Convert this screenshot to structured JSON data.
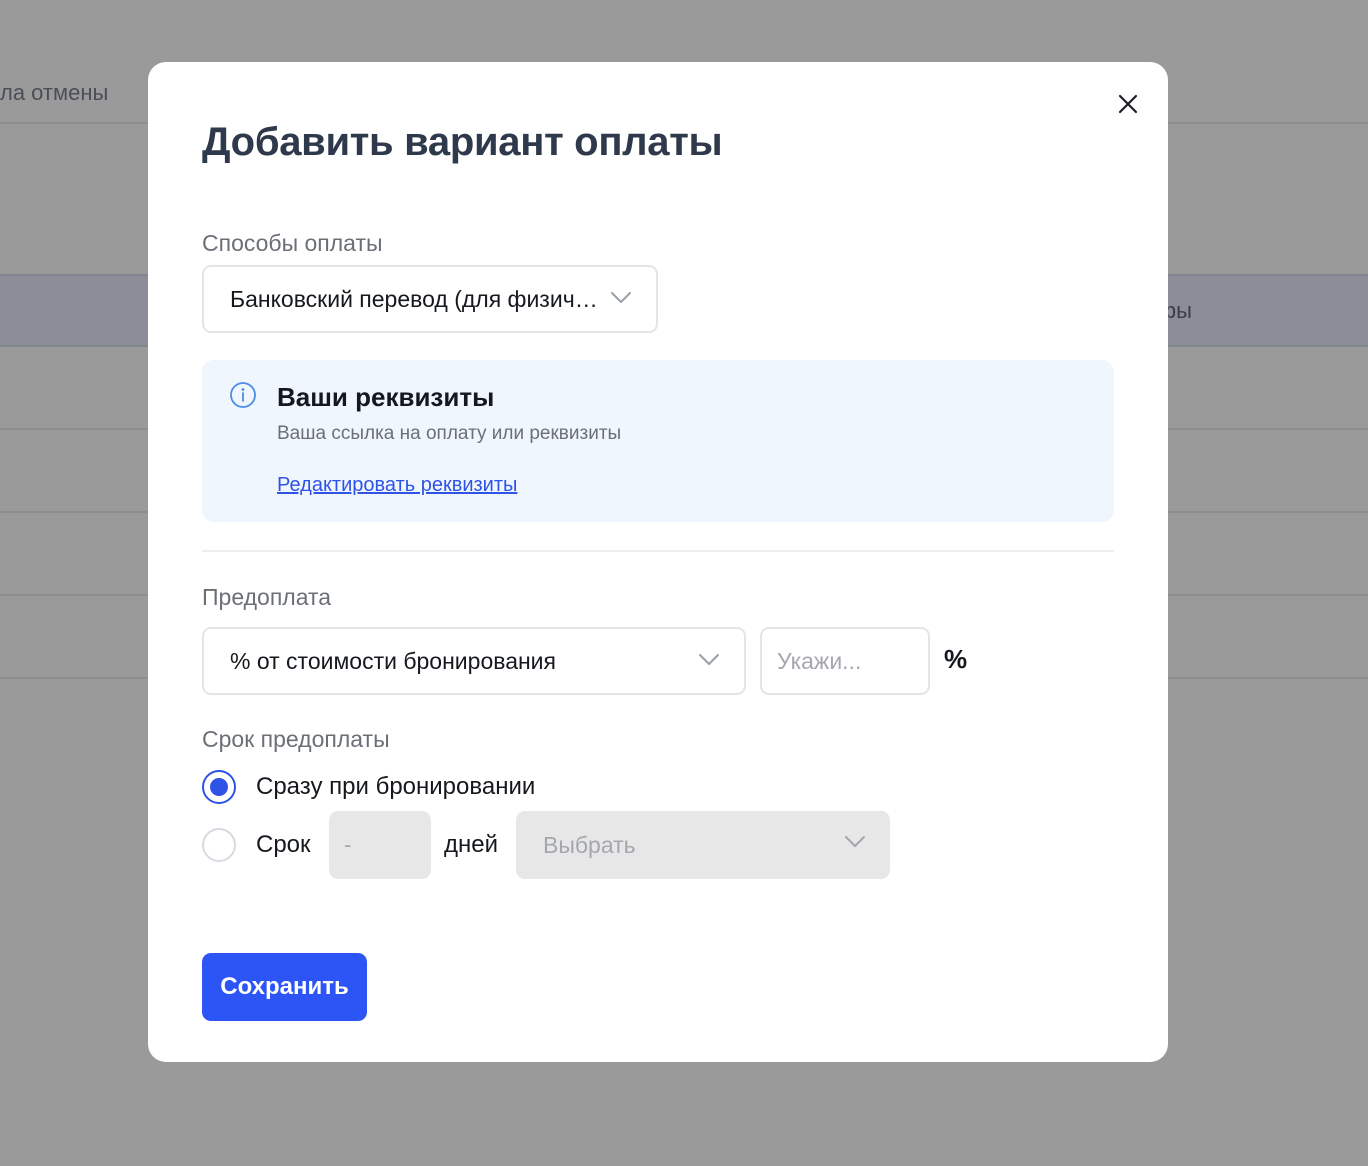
{
  "background": {
    "left_text": "ла отмены",
    "right_text": "фы"
  },
  "modal": {
    "title": "Добавить вариант оплаты",
    "close_icon": "close-icon",
    "payment_methods": {
      "label": "Способы оплаты",
      "selected": "Банковский перевод (для физических лиц)"
    },
    "info": {
      "icon": "info-icon",
      "title": "Ваши реквизиты",
      "subtitle": "Ваша ссылка на оплату или реквизиты",
      "link": "Редактировать реквизиты"
    },
    "prepayment": {
      "label": "Предоплата",
      "type_selected": "% от стоимости бронирования",
      "amount_placeholder": "Укажи...",
      "amount_value": "",
      "unit": "%"
    },
    "prepayment_term": {
      "label": "Срок предоплаты",
      "option_immediate": "Сразу при бронировании",
      "option_term": "Срок",
      "days_placeholder": "-",
      "days_label": "дней",
      "when_placeholder": "Выбрать",
      "selected_option": "immediate"
    },
    "save_button": "Сохранить"
  },
  "colors": {
    "accent": "#2d55f6",
    "title": "#2e3a4b",
    "info_bg": "#eff6fd",
    "backdrop": "#9a9a9a"
  }
}
